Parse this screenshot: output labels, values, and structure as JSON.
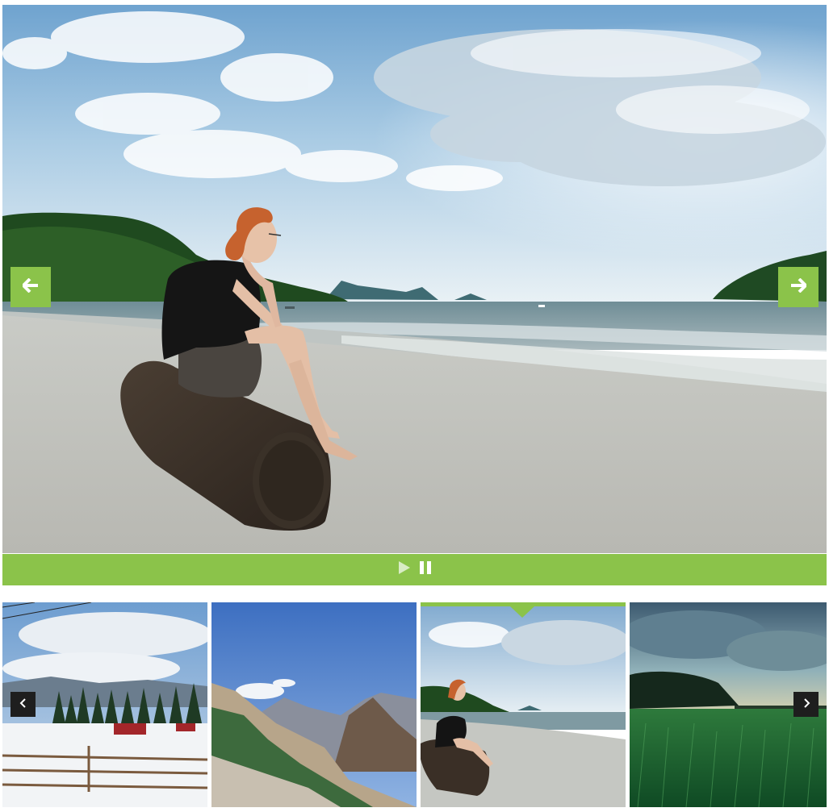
{
  "slider": {
    "current_slide": 3,
    "accent_color": "#8bc34a",
    "main_image": "woman-sitting-on-log-at-beach",
    "prev_icon": "arrow-left-icon",
    "next_icon": "arrow-right-icon"
  },
  "controls": {
    "play_icon": "play-icon",
    "pause_icon": "pause-icon"
  },
  "thumbnails": [
    {
      "scene": "snowy-farm-with-fence"
    },
    {
      "scene": "rocky-mountain-valley"
    },
    {
      "scene": "woman-on-beach",
      "active": true
    },
    {
      "scene": "green-grass-field-at-dusk"
    }
  ],
  "thumbnail_nav": {
    "prev_icon": "chevron-left-icon",
    "next_icon": "chevron-right-icon",
    "bg_color": "#1e1e1e"
  }
}
